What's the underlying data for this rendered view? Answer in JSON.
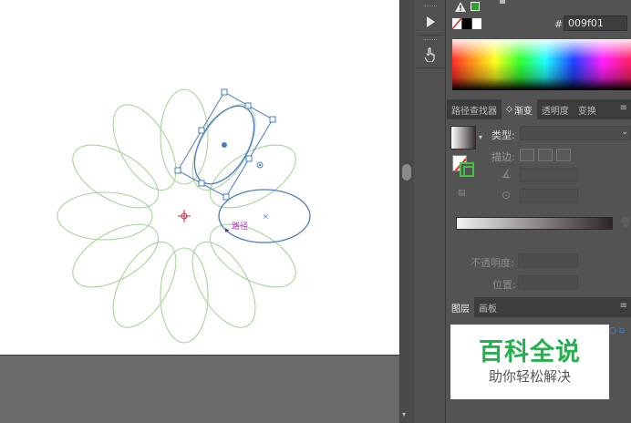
{
  "canvas": {
    "path_label": "路径"
  },
  "tools": [
    {
      "name": "play-icon"
    },
    {
      "name": "hand-pointer-icon"
    }
  ],
  "color_panel": {
    "hash": "#",
    "hex_value": "009f01",
    "accent_green": "#2ea02e"
  },
  "gradient_tabs": {
    "items": [
      "路径查找器",
      "渐变",
      "透明度",
      "变换"
    ],
    "active": "渐变",
    "gradient_prefix": "◇"
  },
  "gradient_panel": {
    "type_label": "类型:",
    "stroke_label": "描边:",
    "opacity_label": "不透明度:",
    "location_label": "位置:"
  },
  "layers_tabs": {
    "items": [
      "图层",
      "画板"
    ],
    "active": "图层"
  },
  "watermark": {
    "title": "百科全说",
    "subtitle": "助你轻松解决",
    "color": "#22b14c"
  },
  "colors": {
    "petal_stroke": "#9ccf8a",
    "selection_blue": "#4a7cc0",
    "path_label_color": "#b03cc0"
  }
}
